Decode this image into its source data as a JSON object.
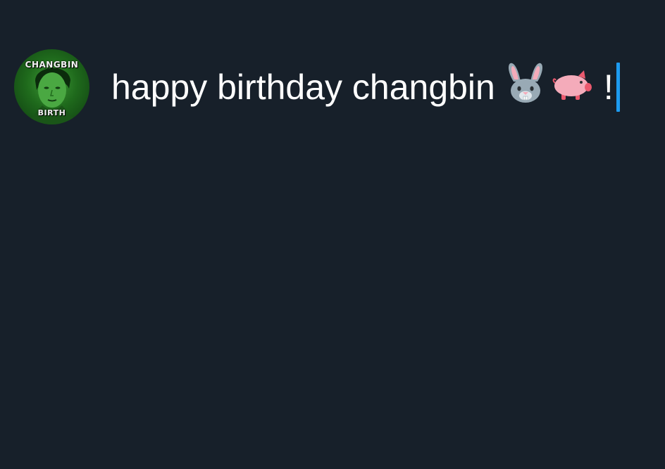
{
  "avatar": {
    "top_text": "CHANGBIN",
    "bottom_text": "BIRTH"
  },
  "compose": {
    "text": "happy birthday changbin",
    "emojis": [
      "rabbit-face-icon",
      "pig-icon"
    ],
    "suffix": "!"
  },
  "colors": {
    "background": "#17202a",
    "text": "#ffffff",
    "caret": "#1d9bf0",
    "avatar_tint": "#2e7d2a"
  }
}
